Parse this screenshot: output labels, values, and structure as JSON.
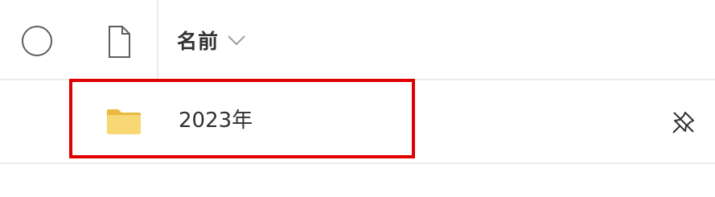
{
  "header": {
    "name_column_label": "名前",
    "select_all_icon": "circle-checkbox-icon",
    "file_type_icon": "document-icon",
    "sort_icon": "chevron-down-icon"
  },
  "items": [
    {
      "name": "2023年",
      "type_icon": "folder-icon",
      "action_icon": "pin-off-icon"
    }
  ],
  "colors": {
    "folder": "#f8d775",
    "folder_tab": "#e9b940",
    "highlight": "#e00000",
    "text": "#323130",
    "divider": "#edebe9"
  }
}
